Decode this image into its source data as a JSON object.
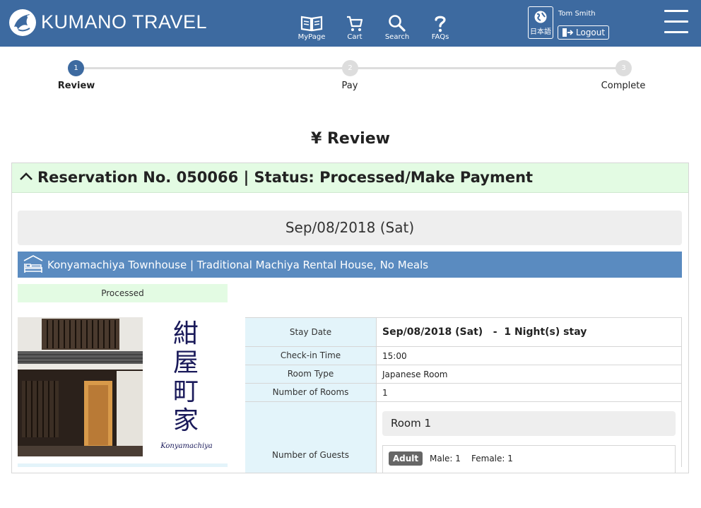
{
  "header": {
    "brand": "KUMANO TRAVEL",
    "nav": [
      {
        "label": "MyPage",
        "icon": "book-icon"
      },
      {
        "label": "Cart",
        "icon": "cart-icon"
      },
      {
        "label": "Search",
        "icon": "search-icon"
      },
      {
        "label": "FAQs",
        "icon": "question-icon"
      }
    ],
    "language_label": "日本語",
    "user_name": "Tom Smith",
    "logout_label": "Logout"
  },
  "stepper": {
    "steps": [
      {
        "number": "1",
        "label": "Review",
        "active": true
      },
      {
        "number": "2",
        "label": "Pay",
        "active": false
      },
      {
        "number": "3",
        "label": "Complete",
        "active": false
      }
    ]
  },
  "page_title": "¥ Review",
  "reservation": {
    "heading": "Reservation No. 050066 | Status: Processed/Make Payment",
    "date": "Sep/08/2018 (Sat)",
    "facility": "Konyamachiya Townhouse | Traditional Machiya Rental House, No Meals",
    "status_tag": "Processed",
    "logo_kanji": [
      "紺",
      "屋",
      "町",
      "家"
    ],
    "logo_romaji": "Konyamachiya",
    "details": {
      "stay_date_label": "Stay Date",
      "stay_date_value": "Sep/08/2018 (Sat)   -  1 Night(s) stay",
      "checkin_label": "Check-in Time",
      "checkin_value": "15:00",
      "room_type_label": "Room Type",
      "room_type_value": "Japanese Room",
      "rooms_label": "Number of Rooms",
      "rooms_value": "1",
      "guests_label": "Number of Guests",
      "room_name": "Room 1",
      "adult_badge": "Adult",
      "male": "Male: 1",
      "female": "Female: 1"
    }
  },
  "colors": {
    "header_bg": "#3d6aa0",
    "facility_bar": "#5a8bc0",
    "status_green": "#e3fbe3",
    "label_blue": "#e3f4fa",
    "step_active": "#3d6aa0",
    "step_inactive": "#dddddd"
  }
}
